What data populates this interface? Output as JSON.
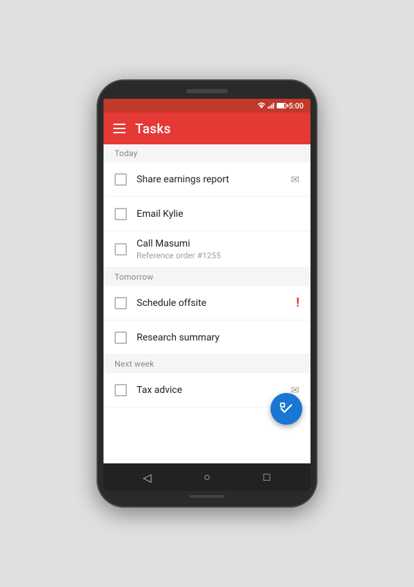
{
  "statusBar": {
    "time": "5:00"
  },
  "appBar": {
    "title": "Tasks"
  },
  "sections": [
    {
      "id": "today",
      "label": "Today",
      "tasks": [
        {
          "id": "share-earnings",
          "title": "Share earnings report",
          "subtitle": null,
          "icon": "email",
          "iconSymbol": "✉"
        },
        {
          "id": "email-kylie",
          "title": "Email Kylie",
          "subtitle": null,
          "icon": null,
          "iconSymbol": null
        },
        {
          "id": "call-masumi",
          "title": "Call Masumi",
          "subtitle": "Reference order #1255",
          "icon": null,
          "iconSymbol": null
        }
      ]
    },
    {
      "id": "tomorrow",
      "label": "Tomorrow",
      "tasks": [
        {
          "id": "schedule-offsite",
          "title": "Schedule offsite",
          "subtitle": null,
          "icon": "urgent",
          "iconSymbol": "!"
        },
        {
          "id": "research-summary",
          "title": "Research summary",
          "subtitle": null,
          "icon": null,
          "iconSymbol": null
        }
      ]
    },
    {
      "id": "next-week",
      "label": "Next week",
      "tasks": [
        {
          "id": "tax-advice",
          "title": "Tax advice",
          "subtitle": null,
          "icon": "email",
          "iconSymbol": "✉"
        }
      ]
    }
  ],
  "nav": {
    "back": "◁",
    "home": "○",
    "recent": "□"
  },
  "fab": {
    "icon": "✓"
  }
}
